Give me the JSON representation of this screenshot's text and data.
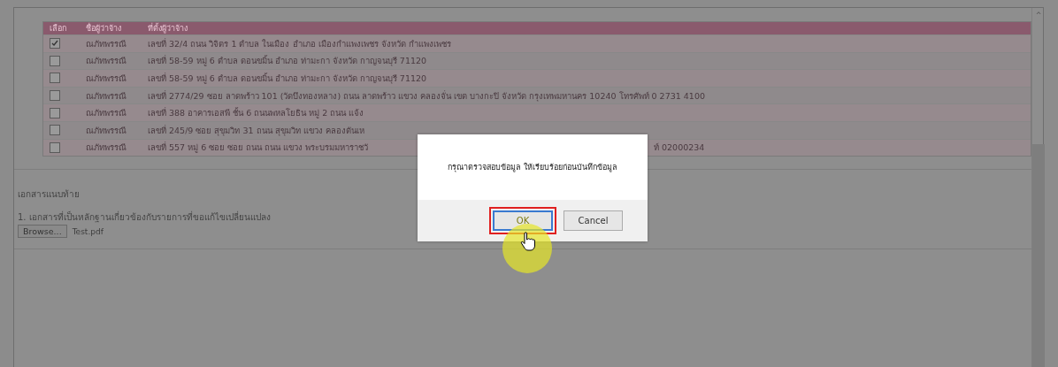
{
  "table": {
    "columns": [
      "เลือก",
      "ชื่อผู้ว่าจ้าง",
      "ที่ตั้งผู้ว่าจ้าง"
    ],
    "rows": [
      {
        "checked": true,
        "name": "ณภัทพรรณี",
        "address": "เลขที่ 32/4 ถนน วิจิตร 1 ตำบล ในเมือง อำเภอ เมืองกำแพงเพชร จังหวัด กำแพงเพชร"
      },
      {
        "checked": false,
        "name": "ณภัทพรรณี",
        "address": "เลขที่ 58-59 หมู่ 6 ตำบล ดอนขมิ้น อำเภอ ท่ามะกา จังหวัด กาญจนบุรี 71120"
      },
      {
        "checked": false,
        "name": "ณภัทพรรณี",
        "address": "เลขที่ 58-59 หมู่ 6 ตำบล ดอนขมิ้น อำเภอ ท่ามะกา จังหวัด กาญจนบุรี 71120"
      },
      {
        "checked": false,
        "name": "ณภัทพรรณี",
        "address": "เลขที่ 2774/29 ซอย ลาดพร้าว 101 (วัดบึงทองหลาง) ถนน ลาดพร้าว แขวง คลองจั่น เขต บางกะปิ จังหวัด กรุงเทพมหานคร 10240 โทรศัพท์ 0 2731 4100"
      },
      {
        "checked": false,
        "name": "ณภัทพรรณี",
        "address": "เลขที่ 388 อาคารเอสพี ชั้น 6 ถนนพหลโยธิน หมู่ 2 ถนน แจ้ง"
      },
      {
        "checked": false,
        "name": "ณภัทพรรณี",
        "address": "เลขที่ 245/9 ซอย สุขุมวิท 31 ถนน สุขุมวิท แขวง คลองตันเห"
      },
      {
        "checked": false,
        "name": "ณภัทพรรณี",
        "address": "เลขที่ 557 หมู่ 6 ซอย ซอย ถนน ถนน แขวง พระบรมมหาราชวั",
        "address_tail": "ท์ 02000234"
      }
    ]
  },
  "attachments": {
    "title": "เอกสารแนบท้าย",
    "item": "1. เอกสารที่เป็นหลักฐานเกี่ยวข้องกับรายการที่ขอแก้ไขเปลี่ยนแปลง",
    "browse": "Browse...",
    "file": "Test.pdf"
  },
  "dialog": {
    "message": "กรุณาตรวจสอบข้อมูล ให้เรียบร้อยก่อนบันทึกข้อมูล",
    "buttons": [
      {
        "label": "OK",
        "selected": true
      },
      {
        "label": "Cancel",
        "selected": false
      }
    ]
  },
  "scrollbar": {
    "up": "^"
  }
}
